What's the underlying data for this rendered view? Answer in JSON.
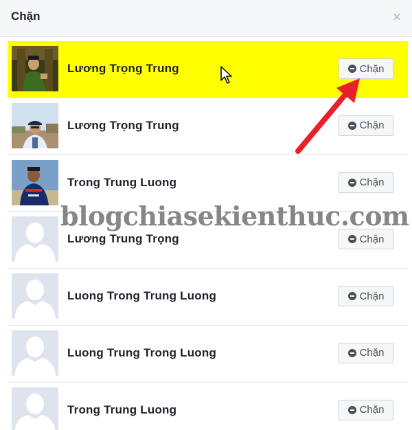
{
  "dialog": {
    "title": "Chặn",
    "close_label": "×"
  },
  "block_label": "Chặn",
  "rows": [
    {
      "name": "Lương Trọng Trung",
      "highlighted": true,
      "avatar": "photo-man-costume"
    },
    {
      "name": "Lương Trọng Trung",
      "highlighted": false,
      "avatar": "photo-man-cap"
    },
    {
      "name": "Trong Trung Luong",
      "highlighted": false,
      "avatar": "photo-man-jersey"
    },
    {
      "name": "Lương Trung Trọng",
      "highlighted": false,
      "avatar": "default-silhouette"
    },
    {
      "name": "Luong Trong Trung Luong",
      "highlighted": false,
      "avatar": "default-silhouette"
    },
    {
      "name": "Luong Trung Trong Luong",
      "highlighted": false,
      "avatar": "default-silhouette"
    },
    {
      "name": "Trong Trung Luong",
      "highlighted": false,
      "avatar": "default-silhouette"
    }
  ],
  "watermark": "blogchiasekienthuc.com",
  "colors": {
    "highlight": "#ffff00",
    "arrow": "#e8202a",
    "header_bg": "#f6f7f9"
  }
}
